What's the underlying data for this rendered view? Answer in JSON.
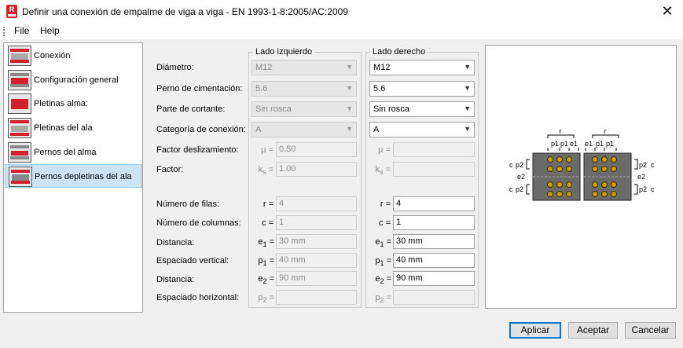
{
  "window": {
    "title": "Definir una conexión de empalme de viga a viga - EN 1993-1-8:2005/AC:2009",
    "close": "✕",
    "icon_letter": "R"
  },
  "menu": {
    "file": "File",
    "help": "Help"
  },
  "tree": [
    {
      "label": "Conexión"
    },
    {
      "label": "Configuración general"
    },
    {
      "label": "Pletinas alma:"
    },
    {
      "label": "Pletinas del ala"
    },
    {
      "label": "Pernos del alma"
    },
    {
      "label": "Pernos depletinas del ala",
      "selected": true
    }
  ],
  "groups": {
    "left": "Lado izquierdo",
    "right": "Lado derecho"
  },
  "labels": {
    "diametro": "Diámetro:",
    "perno": "Perno de cimentación:",
    "parte": "Parte de cortante:",
    "categoria": "Categoría de conexión:",
    "factor_desl": "Factor deslizamiento:",
    "factor": "Factor:",
    "filas": "Número de filas:",
    "columnas": "Número de columnas:",
    "distancia1": "Distancia:",
    "esp_vert": "Espaciado vertical:",
    "distancia2": "Distancia:",
    "esp_horiz": "Espaciado horizontal:"
  },
  "symbols": {
    "mu": "μ =",
    "ks": "k",
    "ks_sub": "s",
    "eq": "=",
    "r": "r =",
    "c": "c =",
    "e": "e",
    "e1_sub": "1",
    "e2_sub": "2",
    "p": "p",
    "p1_sub": "1",
    "p2_sub": "2"
  },
  "left": {
    "diametro": "M12",
    "perno": "5.6",
    "parte": "Sin rosca",
    "categoria": "A",
    "mu": "0.50",
    "ks": "1.00",
    "r": "4",
    "c": "1",
    "e1": "30 mm",
    "p1": "40 mm",
    "e2": "90 mm",
    "p2": ""
  },
  "right": {
    "diametro": "M12",
    "perno": "5.6",
    "parte": "Sin rosca",
    "categoria": "A",
    "mu": "",
    "ks": "",
    "r": "4",
    "c": "1",
    "e1": "30 mm",
    "p1": "40 mm",
    "e2": "90 mm",
    "p2": ""
  },
  "preview": {
    "r": "r",
    "p1": "p1",
    "e1": "e1",
    "p2": "p2",
    "e2": "e2",
    "c": "c"
  },
  "buttons": {
    "apply": "Aplicar",
    "accept": "Aceptar",
    "cancel": "Cancelar"
  },
  "colors": {
    "accent": "#0078d7",
    "brand": "#d4202c",
    "selection": "#cce4f7"
  }
}
